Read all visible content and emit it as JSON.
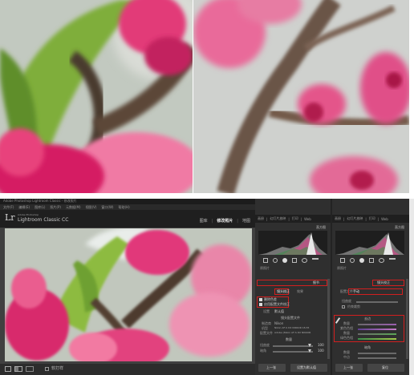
{
  "lr_window": {
    "titlebar_text": "Adobe Photoshop Lightroom Classic - 修改照片",
    "menu_items": [
      "文件(F)",
      "编辑(E)",
      "图库(L)",
      "照片(P)",
      "元数据(M)",
      "视图(V)",
      "窗口(W)",
      "帮助(H)"
    ],
    "logo_mark": "Lr",
    "logo_small": "Adobe Photoshop",
    "logo_name": "Lightroom Classic CC",
    "modules": [
      "图库",
      "修改照片",
      "地图"
    ],
    "modules_right_a": [
      "画册",
      "幻灯片放映",
      "打印",
      "Web"
    ],
    "modules_right_b": [
      "画册",
      "幻灯片放映",
      "打印",
      "Web"
    ],
    "filmstrip_label": "软打样"
  },
  "panel_a": {
    "histogram_title": "直方图",
    "original_label": "原照片",
    "detail_header": "细节",
    "tab_active": "镜头校正",
    "tab_other": "效果",
    "profile_checkbox_1": "删除色差",
    "profile_checkbox_2": "启用配置文件校正",
    "setup_label": "设置",
    "setup_value": "默认值",
    "lens_profile_title": "镜头配置文件",
    "make_label": "制造商",
    "make_value": "Nikon",
    "model_label": "机型",
    "model_value": "Nikon AF-S DX NIKKOR 18-55",
    "profile_label": "配置文件",
    "profile_value": "Adobe (Nikon AF-S DX NIKKOR",
    "amount_title": "数量",
    "distortion_label": "扭曲度",
    "distortion_value": "100",
    "vignetting_label": "暗角",
    "vignetting_value": "100",
    "btn_prev": "上一张",
    "btn_reset": "设置为默认值"
  },
  "panel_b": {
    "histogram_title": "直方图",
    "original_label": "原照片",
    "section_header": "镜头校正",
    "tab_profile": "配置文件",
    "tab_manual": "手动",
    "constraint_label": "约束裁剪",
    "distortion_label": "扭曲度",
    "defringe_title": "去边",
    "amount_label": "数量",
    "purple_hue_label": "紫色色相",
    "green_amount_label": "数量",
    "green_hue_label": "绿色色相",
    "vignetting_title": "暗角",
    "vig_amount_label": "数量",
    "vig_mid_label": "中点",
    "btn_prev": "上一张",
    "btn_reset": "复位"
  }
}
